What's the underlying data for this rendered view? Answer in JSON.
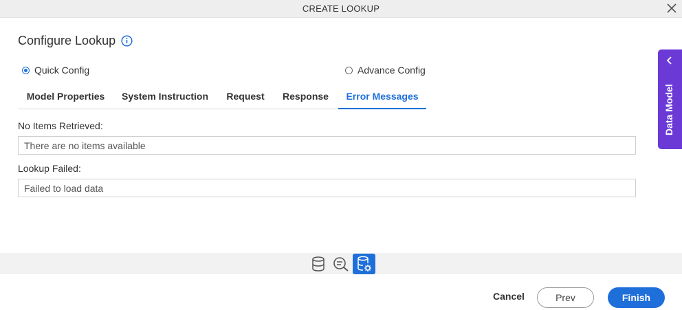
{
  "dialog": {
    "title": "CREATE LOOKUP"
  },
  "page": {
    "heading": "Configure Lookup"
  },
  "config_mode": {
    "quick_label": "Quick Config",
    "advance_label": "Advance Config",
    "selected": "Quick Config"
  },
  "tabs": [
    {
      "label": "Model Properties"
    },
    {
      "label": "System Instruction"
    },
    {
      "label": "Request"
    },
    {
      "label": "Response"
    },
    {
      "label": "Error Messages"
    }
  ],
  "active_tab": "Error Messages",
  "fields": {
    "no_items_label": "No Items Retrieved:",
    "no_items_value": "There are no items available",
    "lookup_failed_label": "Lookup Failed:",
    "lookup_failed_value": "Failed to load data"
  },
  "side_panel": {
    "label": "Data Model"
  },
  "toolstrip": {
    "icons": [
      "database-icon",
      "search-list-icon",
      "database-settings-icon"
    ],
    "active_icon": "database-settings-icon"
  },
  "footer": {
    "cancel_label": "Cancel",
    "prev_label": "Prev",
    "finish_label": "Finish"
  },
  "colors": {
    "accent": "#1e6fd9",
    "side_panel": "#6a39d6",
    "titlebar": "#eeeeee"
  }
}
